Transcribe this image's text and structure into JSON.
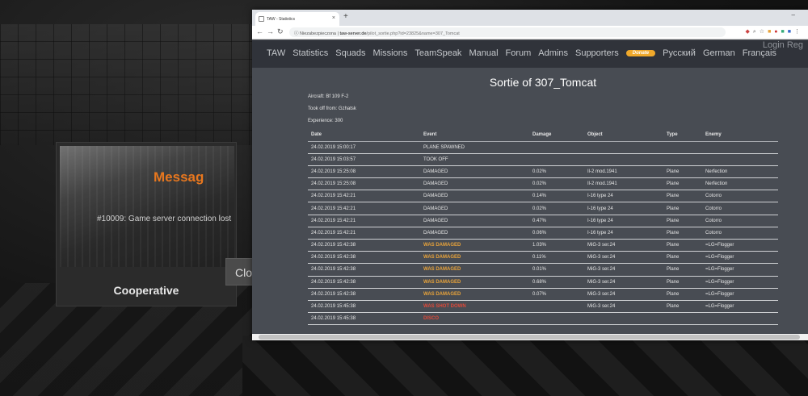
{
  "game": {
    "dialog_title": "Messag",
    "error_message": "#10009: Game server connection lost",
    "mode_label": "Cooperative",
    "close_label": "Clo"
  },
  "browser": {
    "tab_title": "TAW - Statistics",
    "tab_close": "×",
    "new_tab": "+",
    "window_controls": "–",
    "url_security": "Niezabezpieczona",
    "url_host": "taw-server.de",
    "url_path": "/pilot_sortie.php?id=23825&name=307_Tomcat"
  },
  "site": {
    "nav": [
      "TAW",
      "Statistics",
      "Squads",
      "Missions",
      "TeamSpeak",
      "Manual",
      "Forum",
      "Admins",
      "Supporters"
    ],
    "donate_label": "Donate",
    "nav_after": [
      "Русский",
      "German",
      "Français"
    ],
    "login_label": "Login   Reg"
  },
  "sortie": {
    "title": "Sortie of 307_Tomcat",
    "aircraft": "Aircraft: Bf 109 F-2",
    "took_off_from": "Took off from: Gzhatsk",
    "experience": "Experience: 300"
  },
  "table": {
    "headers": [
      "Date",
      "Event",
      "Damage",
      "Object",
      "Type",
      "Enemy"
    ],
    "rows": [
      {
        "date": "24.02.2019 15:00:17",
        "event": "PLANE SPAWNED",
        "style": "normal",
        "damage": "",
        "object": "",
        "type": "",
        "enemy": ""
      },
      {
        "date": "24.02.2019 15:03:57",
        "event": "TOOK OFF",
        "style": "normal",
        "damage": "",
        "object": "",
        "type": "",
        "enemy": ""
      },
      {
        "date": "24.02.2019 15:25:08",
        "event": "DAMAGED",
        "style": "normal",
        "damage": "0.02%",
        "object": "Il-2 mod.1941",
        "type": "Plane",
        "enemy": "Nerfection"
      },
      {
        "date": "24.02.2019 15:25:08",
        "event": "DAMAGED",
        "style": "normal",
        "damage": "0.02%",
        "object": "Il-2 mod.1941",
        "type": "Plane",
        "enemy": "Nerfection"
      },
      {
        "date": "24.02.2019 15:42:21",
        "event": "DAMAGED",
        "style": "normal",
        "damage": "0.14%",
        "object": "I-16 type 24",
        "type": "Plane",
        "enemy": "Cotorro"
      },
      {
        "date": "24.02.2019 15:42:21",
        "event": "DAMAGED",
        "style": "normal",
        "damage": "0.02%",
        "object": "I-16 type 24",
        "type": "Plane",
        "enemy": "Cotorro"
      },
      {
        "date": "24.02.2019 15:42:21",
        "event": "DAMAGED",
        "style": "normal",
        "damage": "0.47%",
        "object": "I-16 type 24",
        "type": "Plane",
        "enemy": "Cotorro"
      },
      {
        "date": "24.02.2019 15:42:21",
        "event": "DAMAGED",
        "style": "normal",
        "damage": "0.06%",
        "object": "I-16 type 24",
        "type": "Plane",
        "enemy": "Cotorro"
      },
      {
        "date": "24.02.2019 15:42:38",
        "event": "WAS DAMAGED",
        "style": "damaged",
        "damage": "1.03%",
        "object": "MiG-3 ser.24",
        "type": "Plane",
        "enemy": "=LG=Flogger"
      },
      {
        "date": "24.02.2019 15:42:38",
        "event": "WAS DAMAGED",
        "style": "damaged",
        "damage": "0.11%",
        "object": "MiG-3 ser.24",
        "type": "Plane",
        "enemy": "=LG=Flogger"
      },
      {
        "date": "24.02.2019 15:42:38",
        "event": "WAS DAMAGED",
        "style": "damaged",
        "damage": "0.01%",
        "object": "MiG-3 ser.24",
        "type": "Plane",
        "enemy": "=LG=Flogger"
      },
      {
        "date": "24.02.2019 15:42:38",
        "event": "WAS DAMAGED",
        "style": "damaged",
        "damage": "0.68%",
        "object": "MiG-3 ser.24",
        "type": "Plane",
        "enemy": "=LG=Flogger"
      },
      {
        "date": "24.02.2019 15:42:38",
        "event": "WAS DAMAGED",
        "style": "damaged",
        "damage": "0.07%",
        "object": "MiG-3 ser.24",
        "type": "Plane",
        "enemy": "=LG=Flogger"
      },
      {
        "date": "24.02.2019 15:45:38",
        "event": "WAS SHOT DOWN",
        "style": "shotdown",
        "damage": "",
        "object": "MiG-3 ser.24",
        "type": "Plane",
        "enemy": "=LG=Flogger"
      },
      {
        "date": "24.02.2019 15:45:38",
        "event": "DISCO",
        "style": "disco",
        "damage": "",
        "object": "",
        "type": "",
        "enemy": ""
      }
    ]
  },
  "colors": {
    "site_bg": "#484c53",
    "nav_bg": "#30333a",
    "was_damaged": "#e8a33a",
    "shot_down": "#e04a3a",
    "game_accent": "#e8771e",
    "donate": "#f0a92b"
  }
}
